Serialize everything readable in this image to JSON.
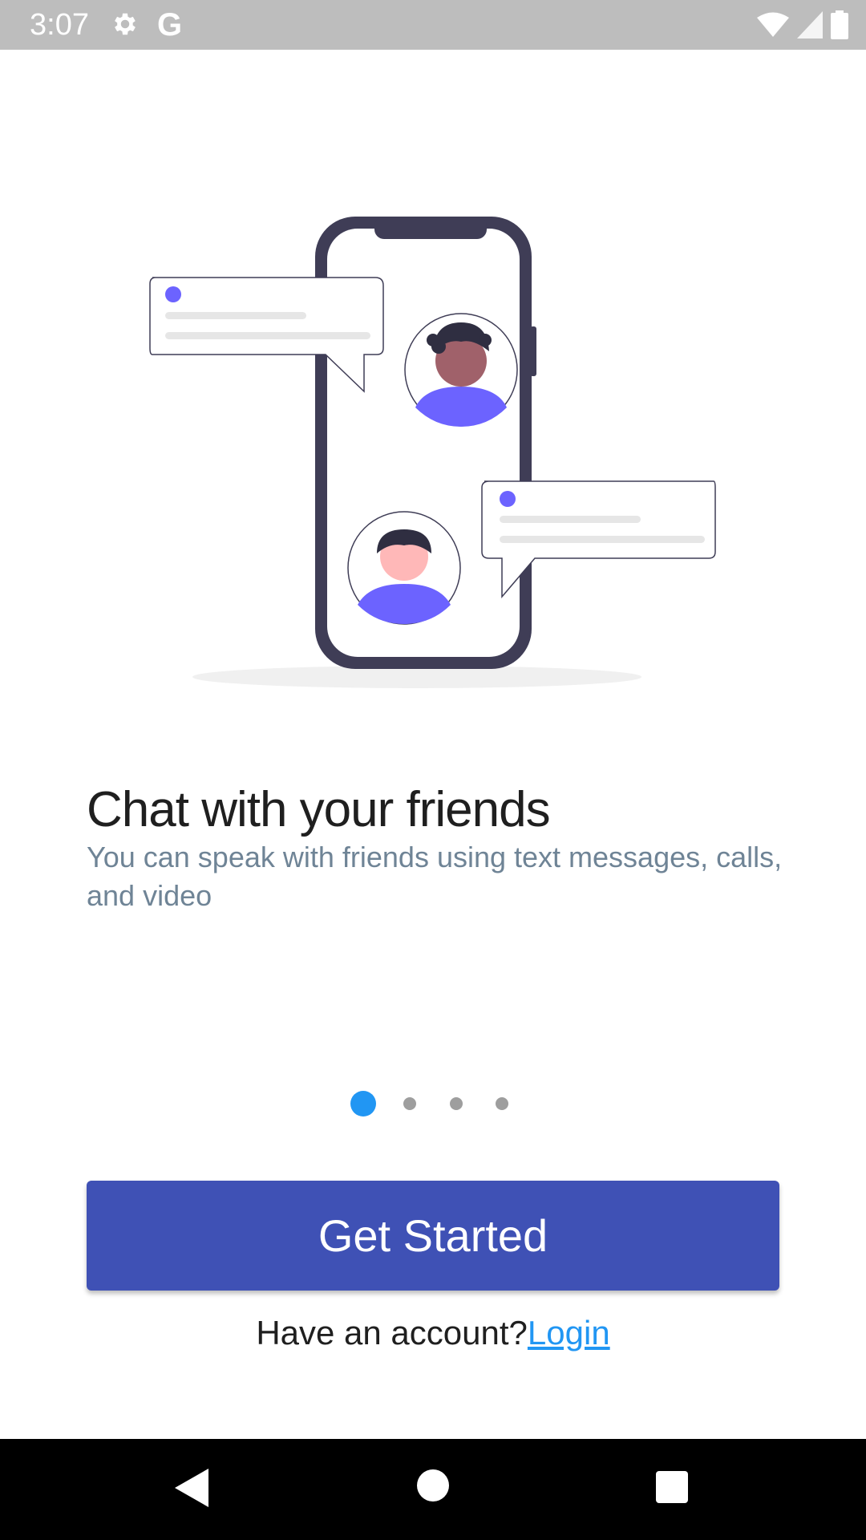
{
  "status_bar": {
    "time": "3:07",
    "icons": [
      "gear-icon",
      "google-g-icon",
      "wifi-icon",
      "signal-icon",
      "battery-icon"
    ],
    "google_letter": "G"
  },
  "onboarding": {
    "title": "Chat with your friends",
    "subtitle": "You can speak with friends using text messages, calls, and video",
    "page_indicator": {
      "count": 4,
      "active_index": 0
    }
  },
  "actions": {
    "get_started_label": "Get Started",
    "account_prompt": "Have an account?",
    "login_label": "Login"
  },
  "colors": {
    "primary": "#3f51b5",
    "accent": "#2196f3",
    "illustration_accent": "#6c63ff",
    "illustration_dark": "#3f3d56"
  },
  "nav_bar": {
    "icons": [
      "back-icon",
      "home-icon",
      "recent-apps-icon"
    ]
  }
}
